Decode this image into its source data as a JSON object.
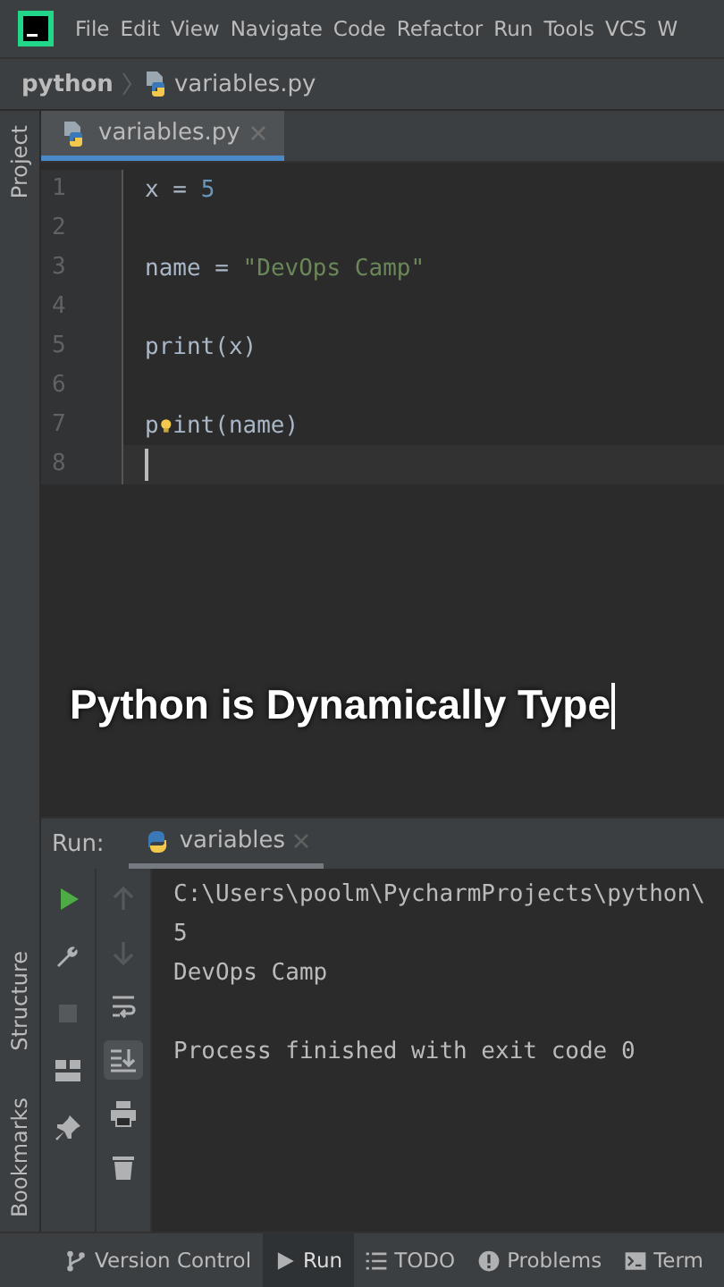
{
  "menu_bar": {
    "items": [
      "File",
      "Edit",
      "View",
      "Navigate",
      "Code",
      "Refactor",
      "Run",
      "Tools",
      "VCS",
      "W"
    ]
  },
  "breadcrumbs": [
    "python",
    "variables.py"
  ],
  "left_strip": {
    "top": [
      "Project"
    ],
    "bottom": [
      "Structure",
      "Bookmarks"
    ]
  },
  "editor_tabs": [
    {
      "label": "variables.py",
      "selected": true
    }
  ],
  "editor": {
    "lines": [
      {
        "number": "1",
        "current": false,
        "tokens": [
          {
            "text": "x = ",
            "kind": "plain"
          },
          {
            "text": "5",
            "kind": "number"
          }
        ]
      },
      {
        "number": "2",
        "current": false
      },
      {
        "number": "3",
        "current": false,
        "tokens": [
          {
            "text": "name = ",
            "kind": "plain"
          },
          {
            "text": "\"DevOps Camp\"",
            "kind": "string"
          }
        ]
      },
      {
        "number": "4",
        "current": false
      },
      {
        "number": "5",
        "current": false,
        "tokens": [
          {
            "text": "print",
            "kind": "builtin"
          },
          {
            "text": "(x)",
            "kind": "plain"
          }
        ]
      },
      {
        "number": "6",
        "current": false
      },
      {
        "number": "7",
        "current": false,
        "tokens": [
          {
            "text": "p",
            "kind": "builtin"
          },
          {
            "kind": "bulb"
          },
          {
            "text": "int",
            "kind": "builtin"
          },
          {
            "text": "(name)",
            "kind": "plain"
          }
        ]
      },
      {
        "number": "8",
        "current": true
      }
    ]
  },
  "caption": "Python is Dynamically Type",
  "run_panel": {
    "label": "Run:",
    "tabs": [
      {
        "label": "variables",
        "selected": true
      }
    ],
    "main_toolbar": [
      {
        "kind": "run",
        "disabled": false
      },
      {
        "kind": "wrench",
        "disabled": false
      },
      {
        "kind": "stop",
        "disabled": true
      },
      {
        "kind": "layout",
        "disabled": false
      },
      {
        "kind": "pin",
        "disabled": false
      }
    ],
    "console_toolbar": [
      {
        "kind": "up",
        "disabled": true,
        "on": false
      },
      {
        "kind": "down",
        "disabled": true,
        "on": false
      },
      {
        "kind": "wrap",
        "disabled": false,
        "on": false
      },
      {
        "kind": "scroll-end",
        "disabled": false,
        "on": true
      },
      {
        "kind": "print",
        "disabled": false,
        "on": false
      },
      {
        "kind": "trash",
        "disabled": false,
        "on": false
      }
    ],
    "console": [
      {
        "lines": [
          "C:\\Users\\poolm\\PycharmProjects\\python\\",
          "5",
          "DevOps Camp"
        ]
      },
      {
        "lines": [
          "Process finished with exit code 0"
        ]
      }
    ]
  },
  "bottom_bar": [
    {
      "kind": "vcs",
      "label": "Version Control",
      "selected": false
    },
    {
      "kind": "run",
      "label": "Run",
      "selected": true
    },
    {
      "kind": "todo",
      "label": "TODO",
      "selected": false
    },
    {
      "kind": "problems",
      "label": "Problems",
      "selected": false
    },
    {
      "kind": "terminal",
      "label": "Term",
      "selected": false
    }
  ]
}
